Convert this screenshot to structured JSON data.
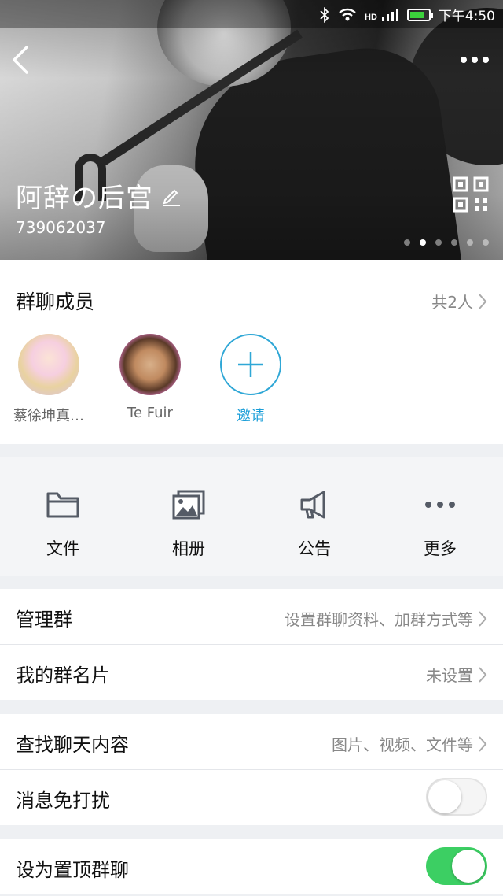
{
  "status_bar": {
    "time": "下午4:50"
  },
  "header": {
    "group_name": "阿辞の后宫",
    "group_id": "739062037",
    "page_indicator": {
      "total": 6,
      "active_index": 1
    }
  },
  "members": {
    "title": "群聊成员",
    "count": "共2人",
    "items": [
      {
        "name": "蔡徐坤真…"
      },
      {
        "name": "Te Fuir"
      }
    ],
    "invite_label": "邀请"
  },
  "tools": [
    {
      "label": "文件",
      "icon": "folder-icon"
    },
    {
      "label": "相册",
      "icon": "album-icon"
    },
    {
      "label": "公告",
      "icon": "megaphone-icon"
    },
    {
      "label": "更多",
      "icon": "more-dots-icon"
    }
  ],
  "settings": {
    "manage": {
      "label": "管理群",
      "value": "设置群聊资料、加群方式等"
    },
    "card": {
      "label": "我的群名片",
      "value": "未设置"
    },
    "search": {
      "label": "查找聊天内容",
      "value": "图片、视频、文件等"
    },
    "mute": {
      "label": "消息免打扰",
      "on": false
    },
    "pin": {
      "label": "设为置顶群聊",
      "on": true
    }
  },
  "colors": {
    "accent": "#2fa7d6",
    "toggle_on": "#3ccf63"
  }
}
